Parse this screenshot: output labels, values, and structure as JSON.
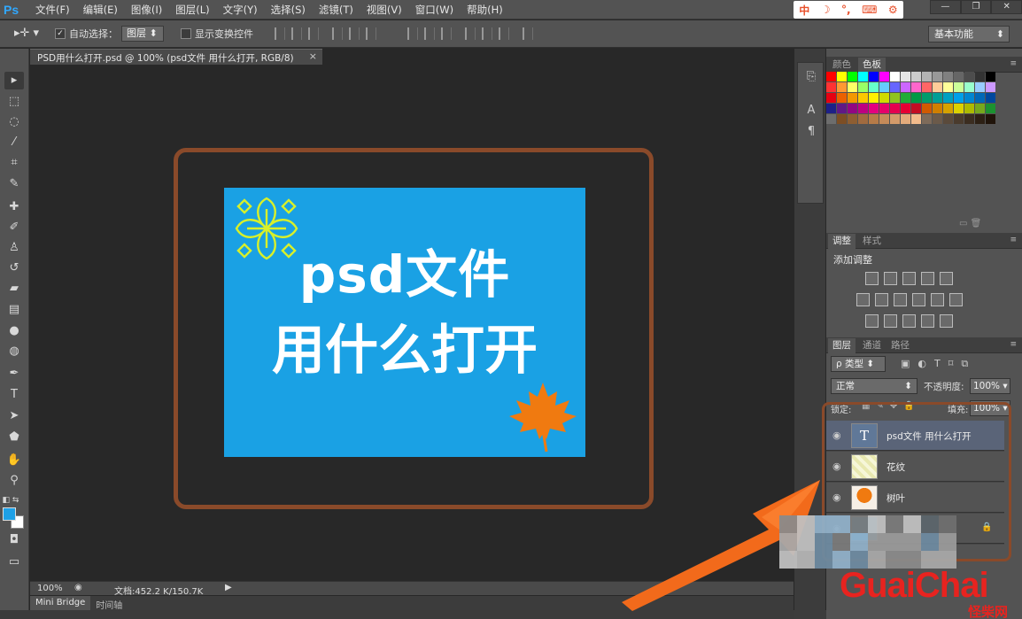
{
  "app": {
    "logo_text": "Ps"
  },
  "menu": [
    "文件(F)",
    "编辑(E)",
    "图像(I)",
    "图层(L)",
    "文字(Y)",
    "选择(S)",
    "滤镜(T)",
    "视图(V)",
    "窗口(W)",
    "帮助(H)"
  ],
  "ime_bar": [
    "中",
    "☽",
    "°,",
    "⌨",
    "⚙"
  ],
  "window_controls": [
    "—",
    "❐",
    "✕"
  ],
  "options_bar": {
    "auto_select_label": "自动选择：",
    "auto_select_checked": true,
    "auto_select_target": "图层",
    "show_transform_label": "显示变换控件",
    "workspace": "基本功能"
  },
  "document_tab": {
    "title": "PSD用什么打开.psd @ 100% (psd文件 用什么打开, RGB/8)",
    "close": "×"
  },
  "document": {
    "bg_color": "#1aa1e4",
    "line1": "psd文件",
    "line2": "用什么打开"
  },
  "status_bar": {
    "zoom": "100%",
    "doc_size": "文档:452.2 K/150.7K"
  },
  "bottom_tabs": [
    "Mini Bridge",
    "时间轴"
  ],
  "panels": {
    "swatches_tabs": [
      "颜色",
      "色板"
    ],
    "adjust_tabs": [
      "调整",
      "样式"
    ],
    "adjust_title": "添加调整",
    "layers_tabs": [
      "图层",
      "通道",
      "路径"
    ],
    "filter_type": "ρ 类型",
    "blend_mode": "正常",
    "opacity_label": "不透明度:",
    "opacity_value": "100%",
    "lock_label": "锁定:",
    "fill_label": "填充:",
    "fill_value": "100%"
  },
  "layers": [
    {
      "name": "psd文件 用什么打开",
      "type": "text",
      "selected": true
    },
    {
      "name": "花纹",
      "type": "pattern",
      "selected": false
    },
    {
      "name": "树叶",
      "type": "image",
      "selected": false
    }
  ],
  "watermark": {
    "logo": "GuaiChai",
    "cn": "怪柴网"
  },
  "colors": {
    "accent_frame": "#8a4a2a",
    "arrow": "#f26a1b",
    "swatches": [
      "#ff0000",
      "#ffff00",
      "#00ff00",
      "#00ffff",
      "#0000ff",
      "#ff00ff",
      "#ffffff",
      "#e6e6e6",
      "#cccccc",
      "#b3b3b3",
      "#999999",
      "#808080",
      "#666666",
      "#4d4d4d",
      "#333333",
      "#000000",
      "#ff3333",
      "#ff9933",
      "#ffff66",
      "#99ff66",
      "#66ffcc",
      "#66ccff",
      "#6666ff",
      "#cc66ff",
      "#ff66cc",
      "#ff6666",
      "#ffcc99",
      "#ffff99",
      "#ccff99",
      "#99ffcc",
      "#99ccff",
      "#cc99ff",
      "#e60012",
      "#eb6100",
      "#f39800",
      "#fcc800",
      "#fff100",
      "#cfdb00",
      "#8fc31f",
      "#22ac38",
      "#009944",
      "#009b6b",
      "#009e96",
      "#00a0c1",
      "#00a0e9",
      "#0086d1",
      "#0068b7",
      "#00479d",
      "#1d2088",
      "#601986",
      "#920783",
      "#be0081",
      "#e4007f",
      "#e5006a",
      "#e5004f",
      "#e60033",
      "#c30d23",
      "#d05a00",
      "#cf7f00",
      "#d6a200",
      "#dbd100",
      "#adba00",
      "#76a81d",
      "#1c9230",
      "#6d6d6d",
      "#7d4e24",
      "#8e5e32",
      "#a16b3f",
      "#b67b48",
      "#c58b59",
      "#d49b6a",
      "#e3ab7b",
      "#f2bb8c",
      "#7e6b5a",
      "#6b5a4a",
      "#5a4a3b",
      "#4a3b2d",
      "#3b2d20",
      "#2d2014",
      "#20140a"
    ]
  }
}
